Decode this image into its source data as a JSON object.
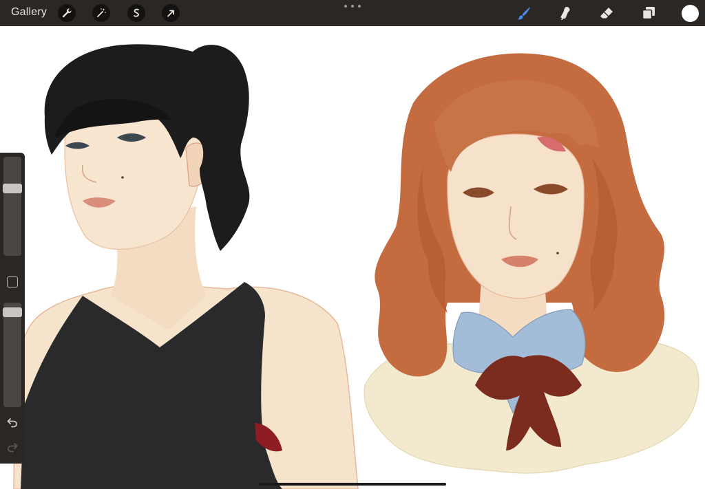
{
  "topbar": {
    "gallery_label": "Gallery",
    "left_tools": [
      "wrench-icon",
      "magic-wand-icon",
      "selection-icon",
      "transform-arrow-icon"
    ],
    "right_tools": [
      "brush-icon",
      "smudge-icon",
      "eraser-icon",
      "layers-icon"
    ],
    "active_tool": "brush-icon",
    "colors": {
      "bar": "#2b2725",
      "active_tool": "#4d8ae6",
      "current_color": "#ffffff"
    }
  },
  "sidebar": {
    "brush_size_level": 0.3,
    "opacity_level": 0.05
  },
  "canvas": {
    "background": "#ffffff",
    "skin": "#f5e2cb",
    "black_hair": "#1a1a1b",
    "auburn_hair": "#c1693f",
    "blue_collar": "#a1bad5",
    "ribbon": "#7a2b1e",
    "cream_fur": "#f2e8cd"
  }
}
